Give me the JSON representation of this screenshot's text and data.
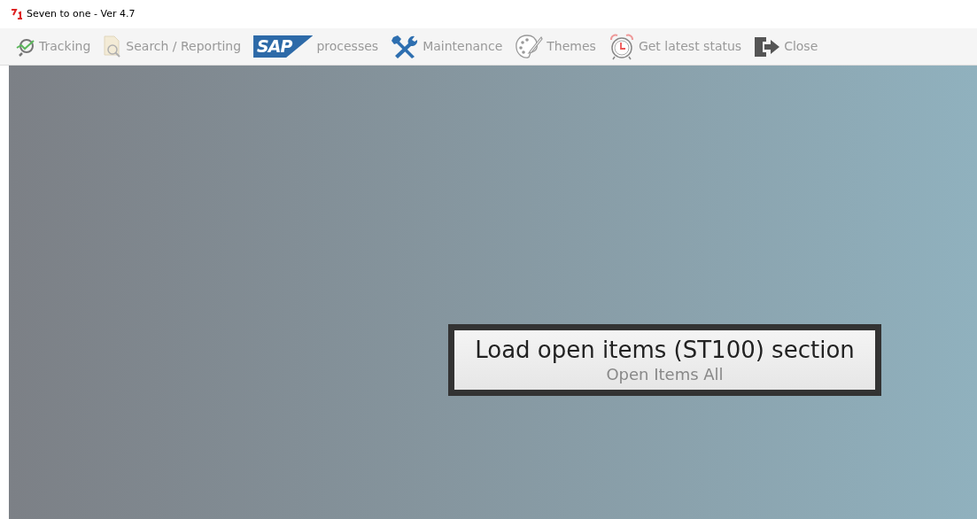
{
  "window": {
    "title": "Seven to one - Ver 4.7"
  },
  "toolbar": [
    {
      "kind": "tracking",
      "label": "Tracking"
    },
    {
      "kind": "search",
      "label": "Search / Reporting"
    },
    {
      "kind": "sap",
      "logo_text": "SAP",
      "label": "processes"
    },
    {
      "kind": "maintenance",
      "label": "Maintenance"
    },
    {
      "kind": "themes",
      "label": "Themes"
    },
    {
      "kind": "alarm",
      "label": "Get latest status"
    },
    {
      "kind": "close",
      "label": "Close"
    }
  ],
  "dialog": {
    "title": "Load open items (ST100) section",
    "subtitle": "Open Items All"
  }
}
